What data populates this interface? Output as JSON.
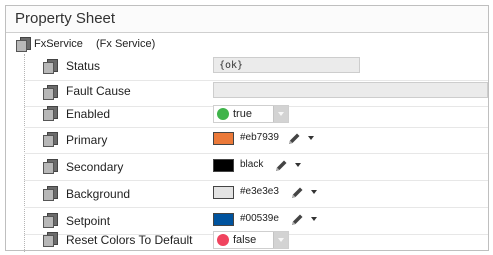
{
  "window": {
    "title": "Property Sheet"
  },
  "root": {
    "name": "FxService",
    "type": "(Fx Service)"
  },
  "properties": {
    "status": {
      "label": "Status",
      "value": "{ok}"
    },
    "fault_cause": {
      "label": "Fault Cause",
      "value": ""
    },
    "enabled": {
      "label": "Enabled",
      "value": "true",
      "indicator_color": "#3fb44a"
    },
    "primary": {
      "label": "Primary",
      "value": "#eb7939",
      "swatch_color": "#eb7939"
    },
    "secondary": {
      "label": "Secondary",
      "value": "black",
      "swatch_color": "#000000"
    },
    "background": {
      "label": "Background",
      "value": "#e3e3e3",
      "swatch_color": "#e3e3e3"
    },
    "setpoint": {
      "label": "Setpoint",
      "value": "#00539e",
      "swatch_color": "#00539e"
    },
    "reset_colors": {
      "label": "Reset Colors To Default",
      "value": "false",
      "indicator_color": "#f0435e"
    }
  },
  "icons": {
    "slot": "slot-icon",
    "edit": "pencil-icon",
    "menu": "caret-down-icon"
  }
}
